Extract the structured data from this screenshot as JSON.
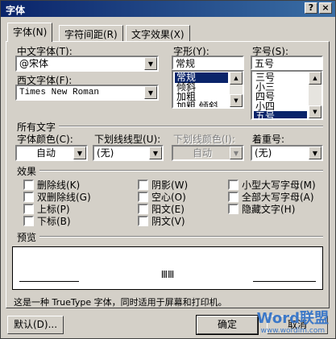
{
  "window": {
    "title": "字体",
    "help_glyph": "?",
    "close_glyph": "×"
  },
  "tabs": [
    {
      "label": "字体(N)",
      "active": true
    },
    {
      "label": "字符间距(R)",
      "active": false
    },
    {
      "label": "文字效果(X)",
      "active": false
    }
  ],
  "chinese_font": {
    "label": "中文字体(T):",
    "value": "@宋体"
  },
  "western_font": {
    "label": "西文字体(F):",
    "value": "Times New Roman"
  },
  "style": {
    "label": "字形(Y):",
    "value": "常规",
    "options": [
      "常规",
      "倾斜",
      "加粗",
      "加粗 倾斜"
    ],
    "selected_index": 0
  },
  "size": {
    "label": "字号(S):",
    "value": "五号",
    "options": [
      "三号",
      "小三",
      "四号",
      "小四",
      "五号"
    ],
    "selected_index": 4
  },
  "all_text": {
    "heading": "所有文字",
    "font_color": {
      "label": "字体颜色(C):",
      "value": "自动"
    },
    "underline_style": {
      "label": "下划线线型(U):",
      "value": "(无)"
    },
    "underline_color": {
      "label": "下划线颜色(I):",
      "value": "自动"
    },
    "emphasis": {
      "label": "着重号:",
      "value": "(无)"
    }
  },
  "effects": {
    "heading": "效果",
    "col1": [
      "删除线(K)",
      "双删除线(G)",
      "上标(P)",
      "下标(B)"
    ],
    "col2": [
      "阴影(W)",
      "空心(O)",
      "阳文(E)",
      "阴文(V)"
    ],
    "col3": [
      "小型大写字母(M)",
      "全部大写字母(A)",
      "隐藏文字(H)"
    ]
  },
  "preview": {
    "heading": "预览",
    "sample": "ⅢⅢ"
  },
  "note": "这是一种 TrueType 字体，同时适用于屏幕和打印机。",
  "buttons": {
    "default_label": "默认(D)...",
    "ok_label": "确定",
    "cancel_label": "取消"
  },
  "watermark": {
    "brand": "Word联盟",
    "url": "www.wordlm.com"
  },
  "colors": {
    "face": "#d4d0c8",
    "title_start": "#0a246a",
    "title_end": "#3a6ea5",
    "selection": "#0a246a",
    "watermark": "#3c78c8"
  }
}
